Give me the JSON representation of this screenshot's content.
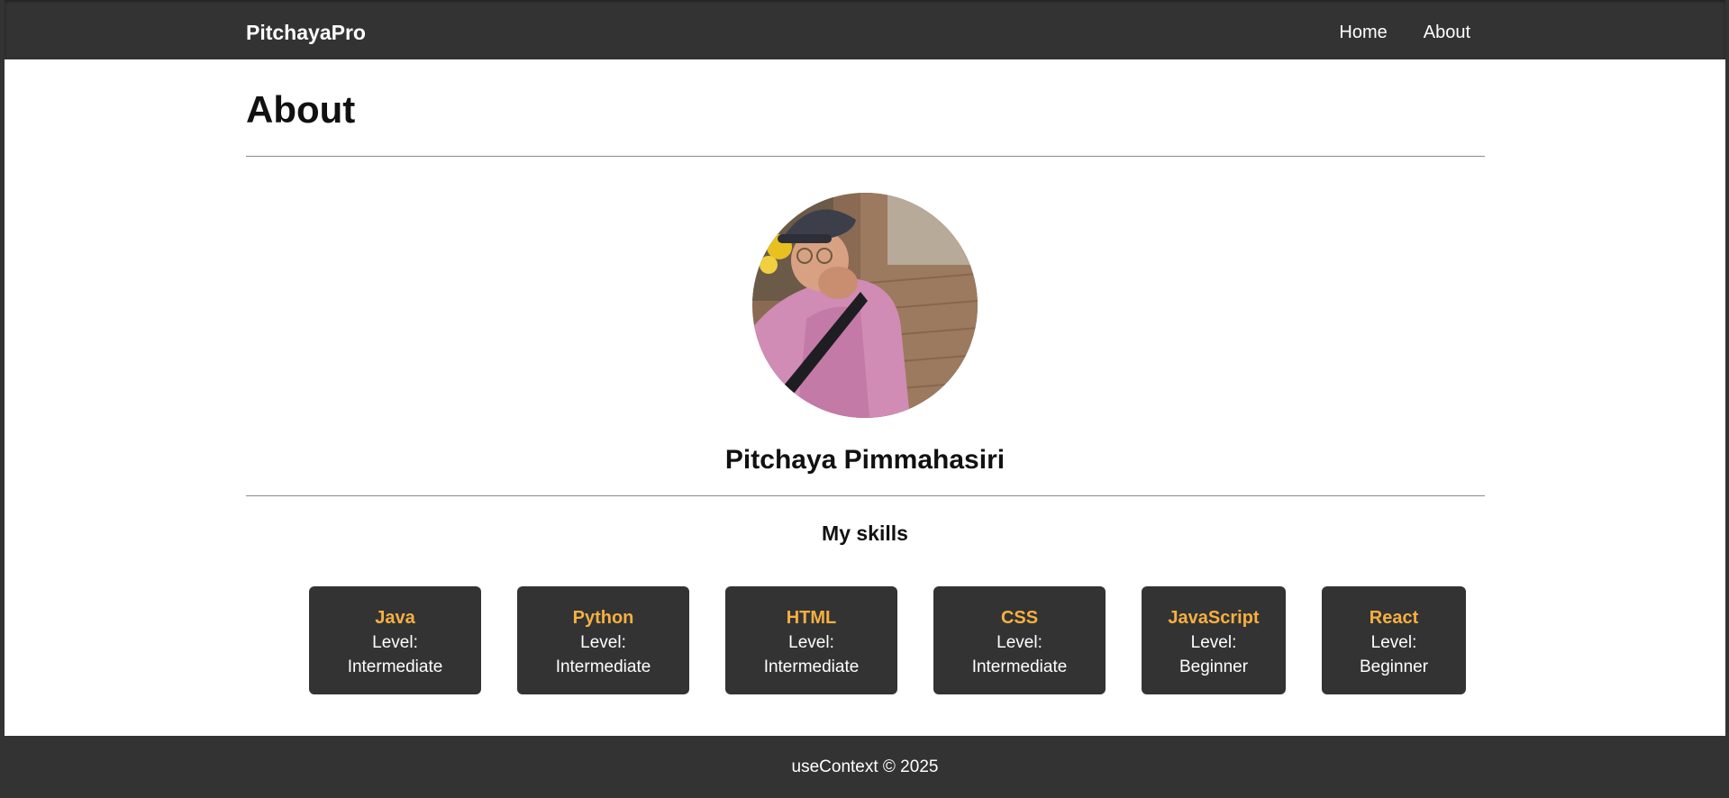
{
  "nav": {
    "brand": "PitchayaPro",
    "links": [
      "Home",
      "About"
    ]
  },
  "page": {
    "title": "About"
  },
  "profile": {
    "name": "Pitchaya Pimmahasiri",
    "photo_icon": "profile-photo"
  },
  "skills": {
    "heading": "My skills",
    "level_prefix": "Level:",
    "items": [
      {
        "name": "Java",
        "level": "Intermediate"
      },
      {
        "name": "Python",
        "level": "Intermediate"
      },
      {
        "name": "HTML",
        "level": "Intermediate"
      },
      {
        "name": "CSS",
        "level": "Intermediate"
      },
      {
        "name": "JavaScript",
        "level": "Beginner"
      },
      {
        "name": "React",
        "level": "Beginner"
      }
    ]
  },
  "footer": {
    "text": "useContext © 2025"
  },
  "colors": {
    "dark": "#333333",
    "accent": "#f5b041",
    "background": "#ffffff"
  }
}
